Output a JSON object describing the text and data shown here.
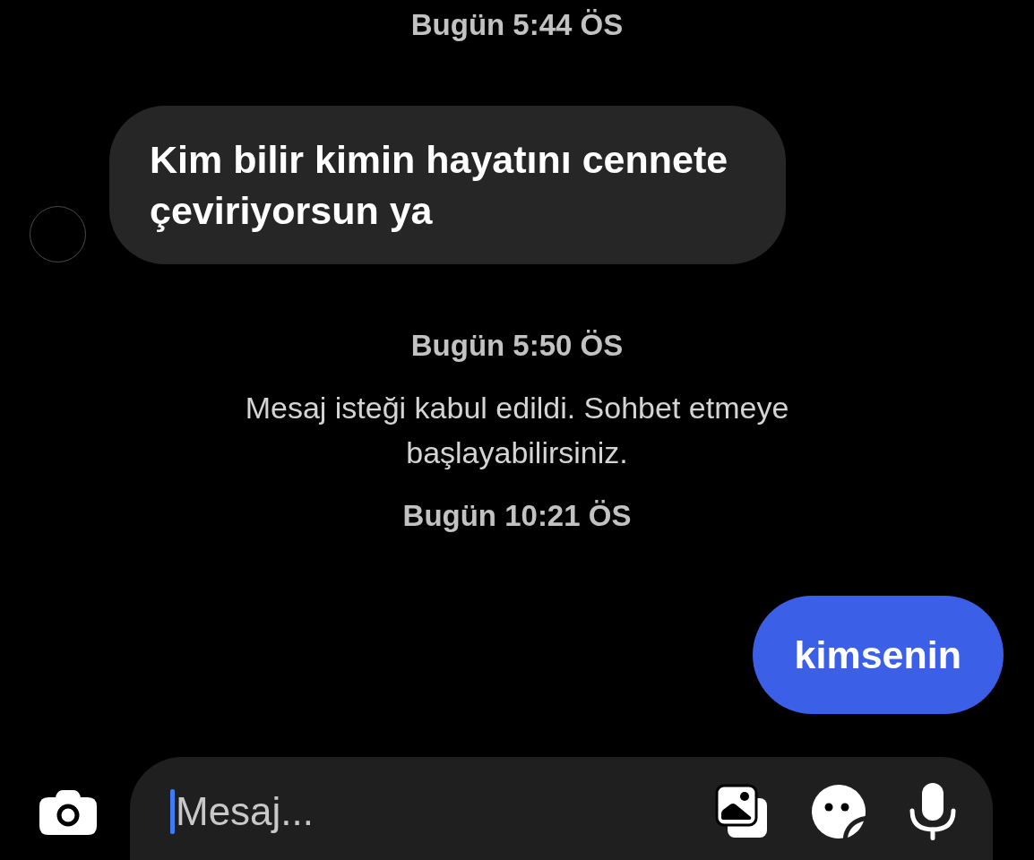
{
  "messages": [
    {
      "kind": "timestamp",
      "text": "Bugün 5:44 ÖS"
    },
    {
      "kind": "incoming",
      "text": "Kim bilir kimin hayatını cennete çeviriyorsun ya"
    },
    {
      "kind": "timestamp",
      "text": "Bugün 5:50 ÖS"
    },
    {
      "kind": "system",
      "text": "Mesaj isteği kabul edildi. Sohbet etmeye başlayabilirsiniz."
    },
    {
      "kind": "timestamp",
      "text": "Bugün 10:21 ÖS"
    },
    {
      "kind": "outgoing",
      "text": "kimsenin"
    }
  ],
  "composer": {
    "placeholder": "Mesaj...",
    "focused": true
  }
}
